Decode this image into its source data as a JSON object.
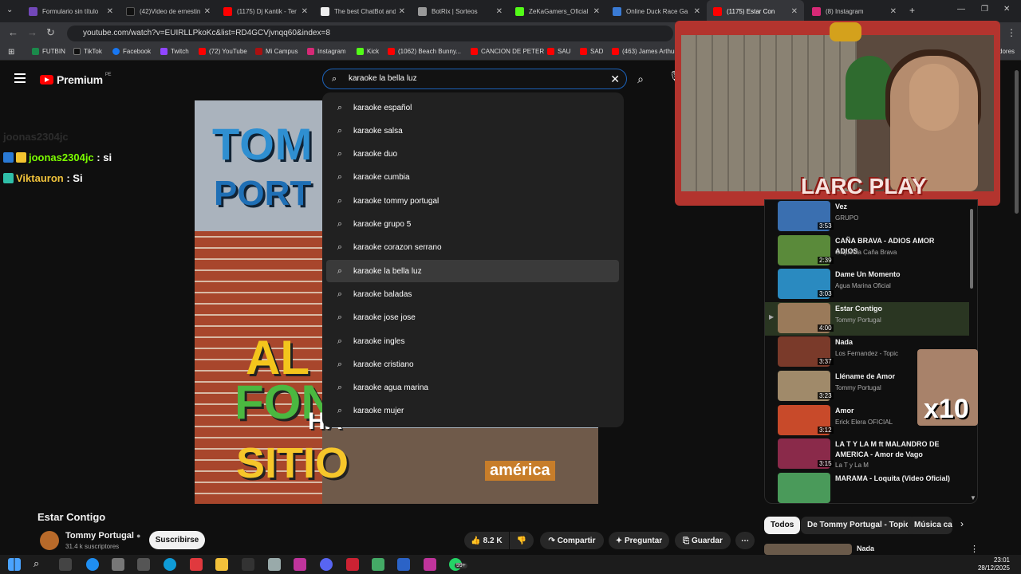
{
  "browser": {
    "tabs": [
      {
        "title": "Formulario sin título",
        "color": "#7248b9"
      },
      {
        "title": "(42)Video de ernestin",
        "color": "#111111"
      },
      {
        "title": "(1175) Dj Kantik - Ter",
        "color": "#ff0000"
      },
      {
        "title": "The best ChatBot and",
        "color": "#222222"
      },
      {
        "title": "BotRix | Sorteos",
        "color": "#444444"
      },
      {
        "title": "ZeKaGamers_Oficial",
        "color": "#2f8f2f"
      },
      {
        "title": "Online Duck Race Ga",
        "color": "#3a7bd5"
      },
      {
        "title": "(1175) Estar Con",
        "color": "#ff0000"
      },
      {
        "title": "(8) Instagram",
        "color": "#d62976"
      }
    ],
    "url": "youtube.com/watch?v=EUIRLLPkoKc&list=RD4GCVjvnqq60&index=8",
    "bookmarks": [
      "FUTBIN",
      "TikTok",
      "Facebook",
      "Twitch",
      "(72) YouTube",
      "Mi Campus",
      "Instagram",
      "Kick",
      "(1062) Beach Bunny...",
      "CANCION DE PETER",
      "SAU",
      "SAD",
      "(463) James Arthur"
    ],
    "bookmarks_overflow": "dores"
  },
  "youtube": {
    "logo_text": "Premium",
    "logo_region": "PE",
    "search_value": "karaoke la bella luz",
    "suggestions": [
      "karaoke español",
      "karaoke salsa",
      "karaoke duo",
      "karaoke cumbia",
      "karaoke tommy portugal",
      "karaoke grupo 5",
      "karaoke corazon serrano",
      "karaoke la bella luz",
      "karaoke baladas",
      "karaoke jose jose",
      "karaoke ingles",
      "karaoke cristiano",
      "karaoke agua marina",
      "karaoke mujer"
    ],
    "highlighted_suggestion_index": 7
  },
  "chat": [
    {
      "user": "joonas2304jc",
      "message": "si",
      "color": "#7cfc00"
    },
    {
      "user": "Viktauron",
      "message": "Si",
      "color": "#f0c23b"
    }
  ],
  "chat_faded": "joonas2304jc",
  "video": {
    "thumb_texts": {
      "top1": "TOM",
      "top2": "PORT",
      "mid1": "AL",
      "mid2": "FON",
      "mid3": "HA",
      "bottom": "SITIO",
      "network": "américa"
    },
    "title": "Estar Contigo",
    "channel": "Tommy Portugal",
    "subscribers": "31.4 k suscriptores",
    "subscribe_label": "Suscribirse",
    "likes": "8.2 K",
    "share_label": "Compartir",
    "ask_label": "Preguntar",
    "save_label": "Guardar"
  },
  "stream_overlay": {
    "brand": "LARC PLAY",
    "meme_text": "x10"
  },
  "playlist": [
    {
      "title": "Vez",
      "channel": "GRUPO",
      "duration": "3:53",
      "thumb": "#3a6fb0"
    },
    {
      "title": "CAÑA BRAVA - ADIOS AMOR ADIOS",
      "channel": "Orquesta Caña Brava",
      "duration": "2:39",
      "thumb": "#5a8a3a"
    },
    {
      "title": "Dame Un Momento",
      "channel": "Agua Marina Oficial",
      "duration": "3:03",
      "thumb": "#2a8ac0"
    },
    {
      "title": "Estar Contigo",
      "channel": "Tommy Portugal",
      "duration": "4:00",
      "thumb": "#9a7a5a"
    },
    {
      "title": "Nada",
      "channel": "Los Fernandez - Topic",
      "duration": "3:37",
      "thumb": "#7a3a2a"
    },
    {
      "title": "Lléname de Amor",
      "channel": "Tommy Portugal",
      "duration": "3:23",
      "thumb": "#a08a6a"
    },
    {
      "title": "Amor",
      "channel": "Erick Elera OFICIAL",
      "duration": "3:12",
      "thumb": "#c84a2a"
    },
    {
      "title": "LA T Y LA M ft MALANDRO DE AMERICA - Amor de Vago",
      "channel": "La T y La M",
      "duration": "3:15",
      "thumb": "#8a2a4a"
    },
    {
      "title": "MARAMA - Loquita (Video Oficial)",
      "channel": "",
      "duration": "",
      "thumb": "#4a9a5a"
    }
  ],
  "playing_index": 3,
  "chips": [
    "Todos",
    "De Tommy Portugal - Topic",
    "Música ca"
  ],
  "next_video_title": "Nada",
  "taskbar": {
    "time": "23:01",
    "date": "28/12/2025",
    "badge": "99+"
  }
}
